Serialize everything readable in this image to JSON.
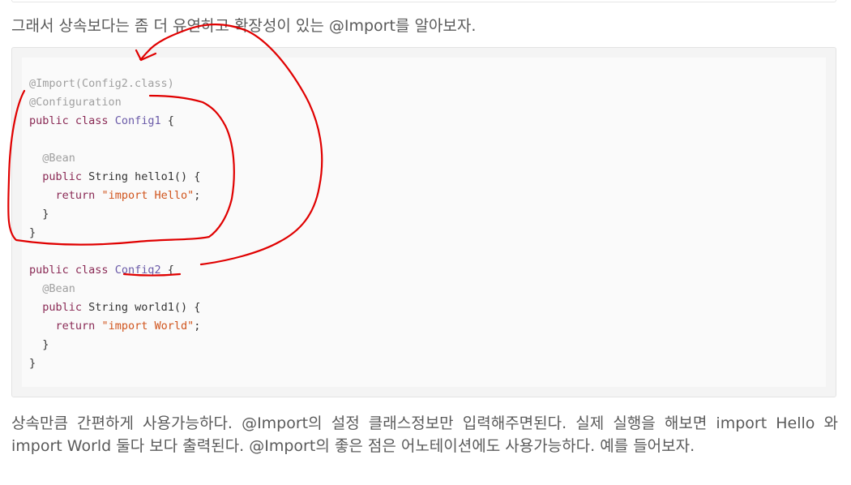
{
  "intro": "그래서 상속보다는 좀 더 유연하고 확장성이 있는 @Import를 알아보자.",
  "code": {
    "l1_ann": "@Import(Config2.class)",
    "l2_ann": "@Configuration",
    "l3_kw": "public class",
    "l3_cls": "Config1",
    "l3_tail": " {",
    "l5_ann": "@Bean",
    "l6_kw": "public",
    "l6_tail": " String hello1() {",
    "l7_kw": "return",
    "l7_str": "\"import Hello\"",
    "l7_tail": ";",
    "l8": "}",
    "l9": "}",
    "l11_kw": "public class",
    "l11_cls": "Config2",
    "l11_tail": " {",
    "l12_ann": "@Bean",
    "l13_kw": "public",
    "l13_tail": " String world1() {",
    "l14_kw": "return",
    "l14_str": "\"import World\"",
    "l14_tail": ";",
    "l15": "}",
    "l16": "}"
  },
  "outro": "상속만큼 간편하게 사용가능하다. @Import의 설정 클래스정보만 입력해주면된다. 실제 실행을 해보면 import Hello 와 import World 둘다 보다 출력된다. @Import의 좋은 점은 어노테이션에도 사용가능하다. 예를 들어보자.",
  "annotation_color": "#e00000"
}
